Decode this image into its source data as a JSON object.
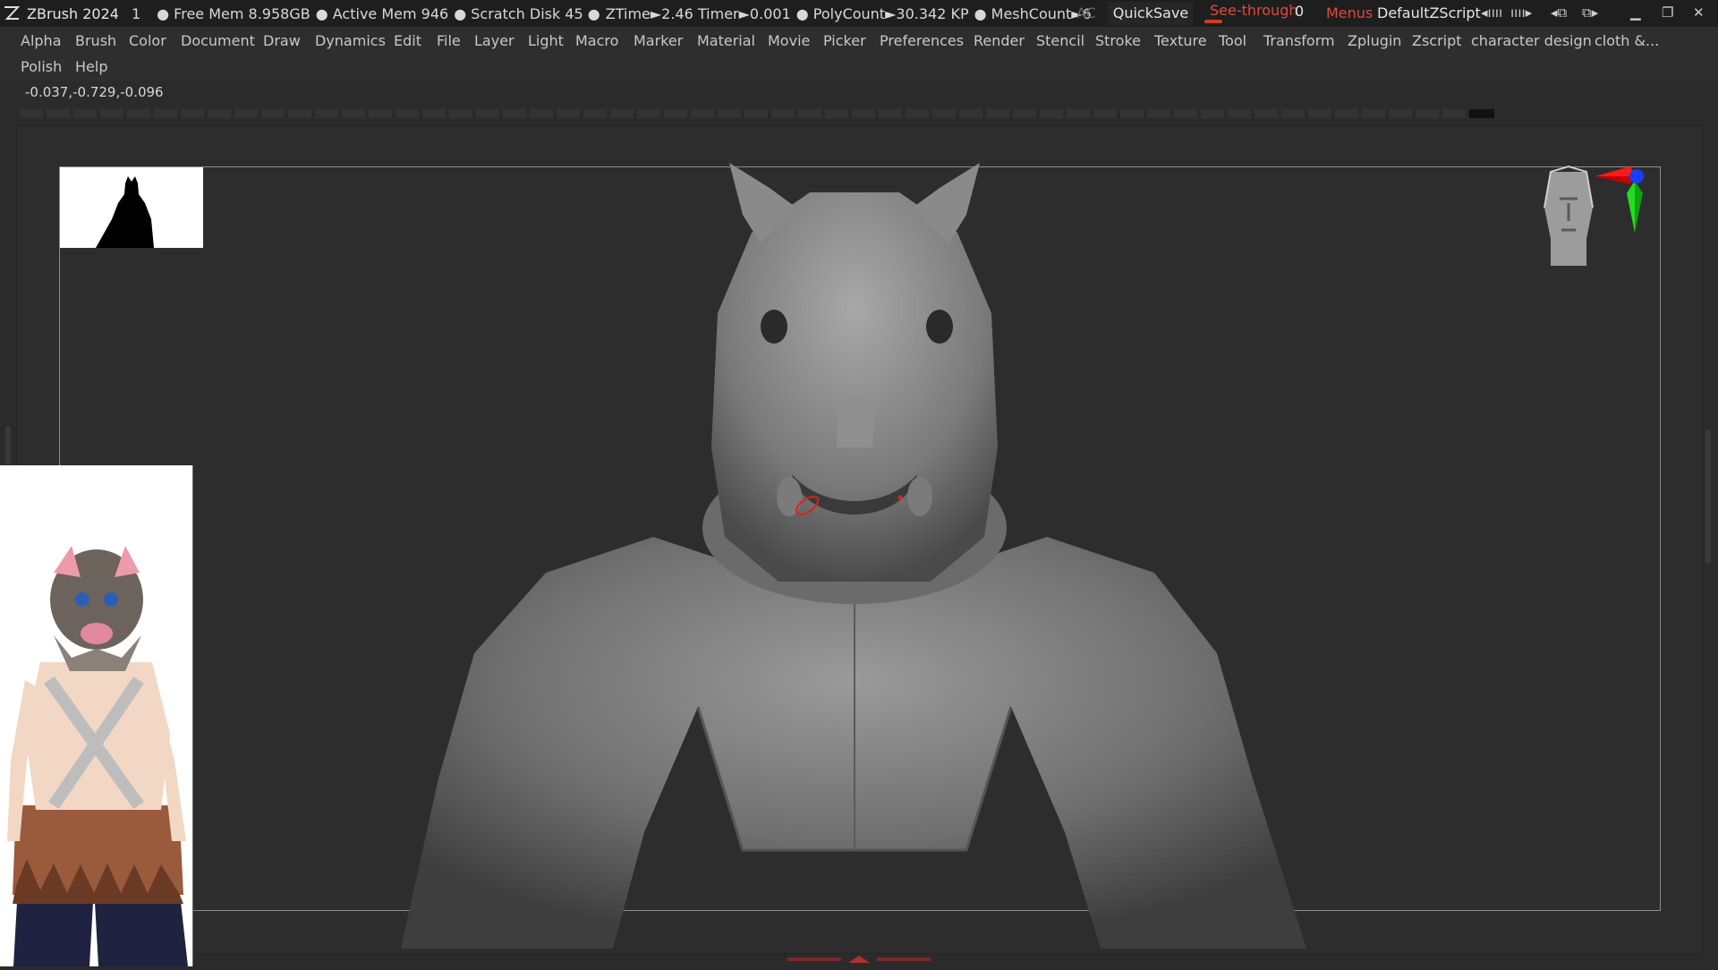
{
  "titlebar": {
    "app": "ZBrush 2024",
    "num": "1",
    "free_mem": "● Free Mem 8.958GB",
    "active_mem": "● Active Mem 946",
    "scratch": "● Scratch Disk 45 ●",
    "ztime": "ZTime►2.46 Timer►0.001",
    "poly": "● PolyCount►30.342 KP",
    "mesh": "● MeshCount►6",
    "ac": "AC",
    "quicksave": "QuickSave",
    "seethrough": "See-through",
    "seethrough_value": "0",
    "menus": "Menus",
    "script": "DefaultZScript"
  },
  "menu": {
    "row1": [
      "Alpha",
      "Brush",
      "Color",
      "Document",
      "Draw",
      "Dynamics",
      "Edit",
      "File",
      "Layer",
      "Light",
      "Macro",
      "Marker",
      "Material",
      "Movie",
      "Picker",
      "Preferences",
      "Render",
      "Stencil",
      "Stroke",
      "Texture",
      "Tool",
      "Transform",
      "Zplugin",
      "Zscript",
      "character design",
      "cloth &..."
    ],
    "row2": [
      "Polish",
      "Help"
    ]
  },
  "coordinates": "-0.037,-0.729,-0.096",
  "colors": {
    "accent_red": "#e04a3a",
    "axis_x": "#ff1a1a",
    "axis_y": "#22dd22",
    "axis_z": "#1a3cff"
  }
}
